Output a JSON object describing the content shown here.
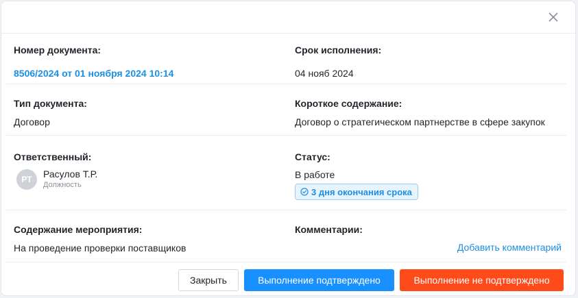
{
  "modal": {
    "close_icon": "close-icon",
    "fields": {
      "doc_number": {
        "label": "Номер документа:",
        "value": "8506/2024 от 01 ноября 2024 10:14"
      },
      "due_date": {
        "label": "Срок исполнения:",
        "value": "04 нояб 2024"
      },
      "doc_type": {
        "label": "Тип документа:",
        "value": "Договор"
      },
      "summary": {
        "label": "Короткое содержание:",
        "value": "Договор о стратегическом партнерстве в сфере закупок"
      },
      "responsible": {
        "label": "Ответственный:",
        "avatar_initials": "РТ",
        "name": "Расулов Т.Р.",
        "position": "Должность"
      },
      "status": {
        "label": "Статус:",
        "value": "В работе",
        "badge_icon": "check-circle-icon",
        "badge_text": "3 дня окончания срока"
      },
      "activity": {
        "label": "Содержание мероприятия:",
        "value": "На проведение проверки поставщиков"
      },
      "comments": {
        "label": "Комментарии:",
        "add_link": "Добавить комментарий"
      }
    },
    "buttons": {
      "close": "Закрыть",
      "confirm": "Выполнение подтверждено",
      "reject": "Выполнение не подтверждено"
    },
    "colors": {
      "accent": "#1a8fe3",
      "primary_button": "#1890ff",
      "danger_button": "#ff4a1a",
      "badge_bg": "#e8f4fd"
    }
  }
}
